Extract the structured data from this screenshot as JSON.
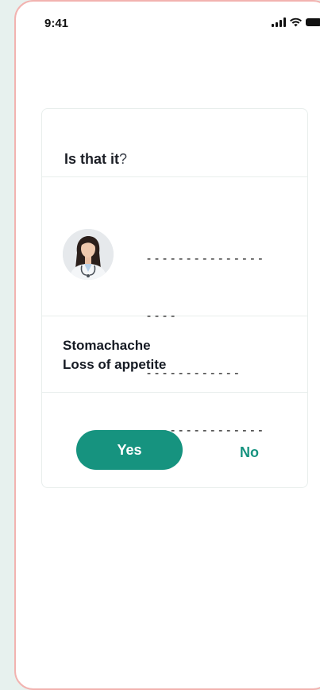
{
  "status_bar": {
    "time": "9:41",
    "icons": [
      "signal-icon",
      "wifi-icon",
      "battery-icon"
    ]
  },
  "card": {
    "question_strong": "Is that it",
    "question_mark": "?",
    "doctor": {
      "avatar_icon": "doctor-avatar",
      "placeholder_lines": [
        "---------------",
        "----",
        "------------",
        "---------------"
      ]
    },
    "symptoms": [
      "Stomachache",
      "Loss of appetite"
    ],
    "yes_label": "Yes",
    "no_label": "No"
  },
  "colors": {
    "accent": "#16937f",
    "background": "#e7f1ee",
    "frame_border": "#f2b3b0"
  }
}
